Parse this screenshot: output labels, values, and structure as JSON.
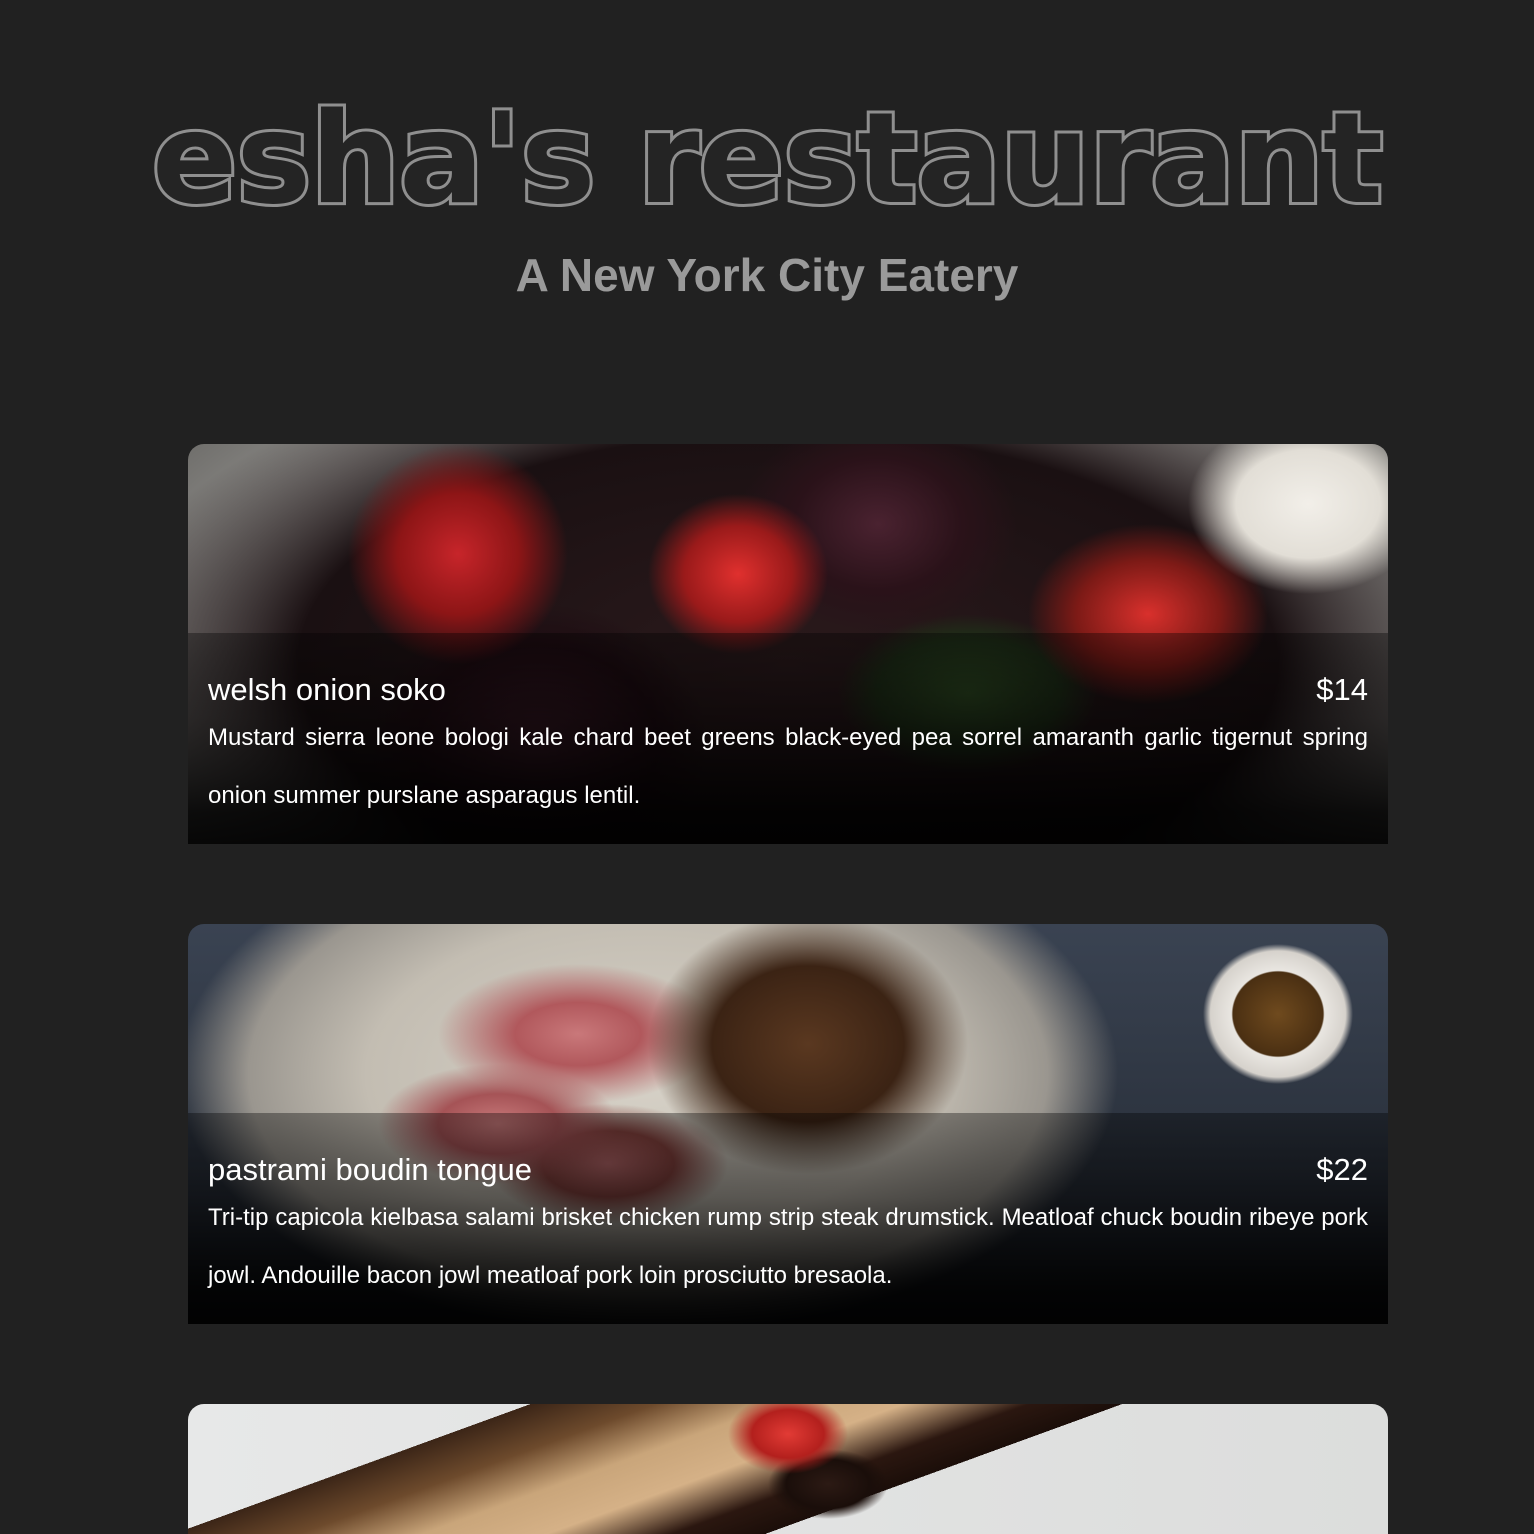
{
  "header": {
    "brand": "esha's restaurant",
    "subtitle": "A New York City Eatery"
  },
  "menu": {
    "items": [
      {
        "name": "welsh onion soko",
        "price": "$14",
        "description": "Mustard sierra leone bologi kale chard beet greens black-eyed pea sorrel amaranth garlic tigernut spring onion summer purslane asparagus lentil."
      },
      {
        "name": "pastrami boudin tongue",
        "price": "$22",
        "description": "Tri-tip capicola kielbasa salami brisket chicken rump strip steak drumstick. Meatloaf chuck boudin ribeye pork jowl. Andouille bacon jowl meatloaf pork loin prosciutto bresaola."
      },
      {
        "name": "",
        "price": "",
        "description": ""
      }
    ]
  },
  "colors": {
    "background": "#212121",
    "brand_fill": "#242424",
    "brand_outline": "#8f8f8f",
    "subtitle": "#9a9a9a",
    "card_text": "#ffffff"
  }
}
